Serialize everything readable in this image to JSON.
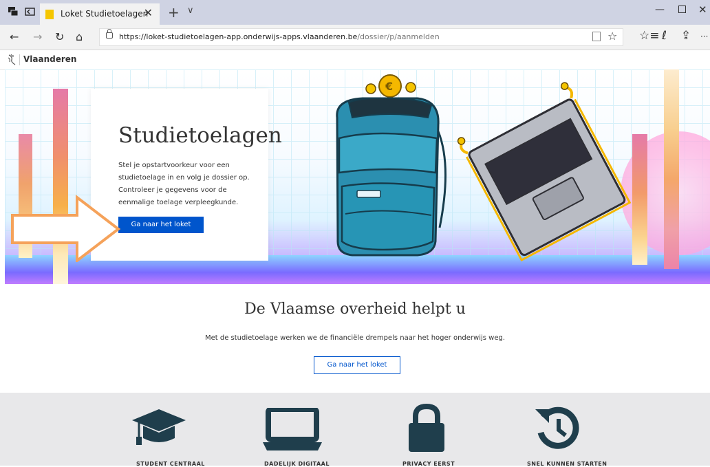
{
  "browser": {
    "tab_title": "Loket Studietoelagen",
    "url_base": "https://loket-studietoelagen-app.onderwijs-apps.vlaanderen.be",
    "url_path": "/dossier/p/aanmelden",
    "tab_close": "✕",
    "new_tab": "+",
    "tab_list": "∨",
    "minimize": "—",
    "close": "✕",
    "back": "←",
    "forward": "→",
    "refresh": "↻",
    "home": "⌂",
    "favorite": "☆",
    "favorites_list": "☆≡",
    "notes": "ℓ",
    "share": "⇪",
    "more": "···"
  },
  "site_header": {
    "brand": "Vlaanderen"
  },
  "hero": {
    "title": "Studietoelagen",
    "text": "Stel je opstartvoorkeur voor een studietoelage in en volg je dossier op. Controleer je gegevens voor de eenmalige toelage verpleegkunde.",
    "button": "Ga naar het loket"
  },
  "section2": {
    "title": "De Vlaamse overheid helpt u",
    "text": "Met de studietoelage werken we de financiële drempels naar het hoger onderwijs weg.",
    "button": "Ga naar het loket"
  },
  "features": [
    {
      "icon": "graduation-cap-icon",
      "label": "STUDENT CENTRAAL"
    },
    {
      "icon": "laptop-icon",
      "label": "DADELIJK DIGITAAL"
    },
    {
      "icon": "lock-icon",
      "label": "PRIVACY EERST"
    },
    {
      "icon": "history-icon",
      "label": "SNEL KUNNEN STARTEN"
    }
  ],
  "colors": {
    "primary": "#0055cc",
    "icon_dark": "#1f3e4c",
    "arrow": "#f5a25a"
  }
}
